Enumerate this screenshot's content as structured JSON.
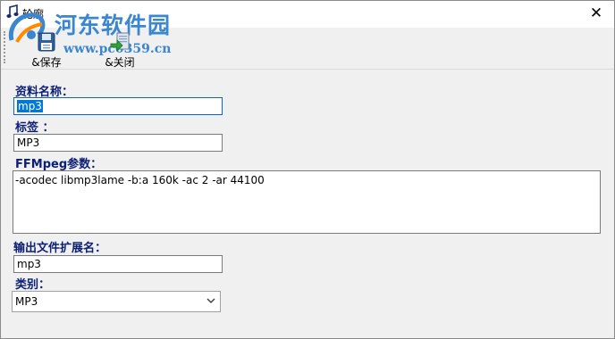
{
  "window": {
    "title": "轮廓",
    "watermark_title": "河东软件园",
    "watermark_url": "www.pc0359.cn"
  },
  "toolbar": {
    "save_label": "&保存",
    "close_label": "&关闭"
  },
  "form": {
    "name_label": "资料名称：",
    "name_value": "mp3",
    "tag_label": "标签 ：",
    "tag_value": "MP3",
    "ffmpeg_label": "FFMpeg参数：",
    "ffmpeg_value": "-acodec libmp3lame -b:a 160k -ac 2 -ar 44100",
    "ext_label": "输出文件扩展名：",
    "ext_value": "mp3",
    "type_label": "类别：",
    "type_selected": "MP3"
  },
  "icons": {
    "app": "music-note-icon",
    "save": "save-disk-icon",
    "close_doc": "close-document-icon",
    "close_window": "close-icon",
    "dropdown": "chevron-down-icon"
  },
  "colors": {
    "label_text": "#0b1f74",
    "selection": "#0078d7",
    "watermark": "#3a86cf"
  }
}
